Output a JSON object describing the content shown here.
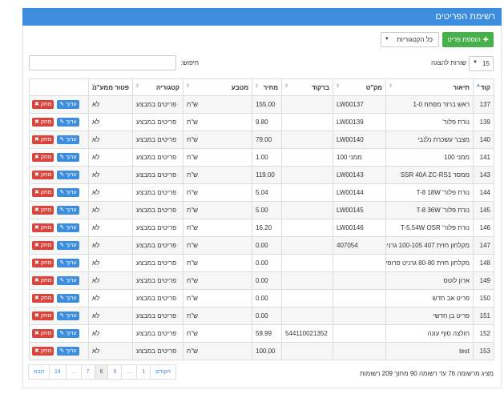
{
  "header": {
    "title": "רשימת הפריטים"
  },
  "toolbar": {
    "add_label": "הוספת פריט",
    "category_select": "כל הקטגוריות",
    "page_length": "15",
    "page_length_label": "שורות להצגה",
    "search_label": "חיפוש:",
    "search_value": ""
  },
  "table": {
    "columns": [
      "קוד",
      "תיאור",
      "מק\"ט",
      "ברקוד",
      "מחיר",
      "מטבע",
      "קטגוריה",
      "פטור ממע\"מ",
      ""
    ],
    "edit_label": "ערוך",
    "delete_label": "מחק",
    "rows": [
      {
        "code": "137",
        "desc": "ראש ברזר מפתח 1-0",
        "sku": "LW00137",
        "barcode": "",
        "price": "155.00",
        "currency": "ש\"ח",
        "category": "פריטים במבצע",
        "vat": "לא"
      },
      {
        "code": "139",
        "desc": "נורת פלור'",
        "sku": "LW00139",
        "barcode": "",
        "price": "9.80",
        "currency": "ש\"ח",
        "category": "פריטים במבצע",
        "vat": "לא"
      },
      {
        "code": "140",
        "desc": "מצבר עשכרת נלנבי",
        "sku": "LW00140",
        "barcode": "",
        "price": "79.00",
        "currency": "ש\"ח",
        "category": "פריטים במבצע",
        "vat": "לא"
      },
      {
        "code": "141",
        "desc": "ממני 100",
        "sku": "ממני 100",
        "barcode": "",
        "price": "1.00",
        "currency": "ש\"ח",
        "category": "פריטים במבצע",
        "vat": "לא"
      },
      {
        "code": "143",
        "desc": "ממסר SSR 40A ZC-RS1",
        "sku": "LW00143",
        "barcode": "",
        "price": "119.00",
        "currency": "ש\"ח",
        "category": "פריטים במבצע",
        "vat": "לא"
      },
      {
        "code": "144",
        "desc": "נורת פלור' T-8 18W",
        "sku": "LW00144",
        "barcode": "",
        "price": "5.04",
        "currency": "ש\"ח",
        "category": "פריטים במבצע",
        "vat": "לא"
      },
      {
        "code": "145",
        "desc": "נורת פלור' T-8 36W",
        "sku": "LW00145",
        "barcode": "",
        "price": "5.00",
        "currency": "ש\"ח",
        "category": "פריטים במבצע",
        "vat": "לא"
      },
      {
        "code": "146",
        "desc": "נורת פלור' T-5.54W OSR",
        "sku": "LW00146",
        "barcode": "",
        "price": "16.20",
        "currency": "ש\"ח",
        "category": "פריטים במבצע",
        "vat": "לא"
      },
      {
        "code": "147",
        "desc": "מקלחון חזית 407 100-105 גרניט",
        "sku": "407054",
        "barcode": "",
        "price": "0.00",
        "currency": "ש\"ח",
        "category": "פריטים במבצע",
        "vat": "לא"
      },
      {
        "code": "148",
        "desc": "מקלחון חזית 80-80 גרניט פרופילון",
        "sku": "",
        "barcode": "",
        "price": "0.00",
        "currency": "ש\"ח",
        "category": "פריטים במבצע",
        "vat": "לא"
      },
      {
        "code": "149",
        "desc": "ארון לוטס",
        "sku": "",
        "barcode": "",
        "price": "0.00",
        "currency": "ש\"ח",
        "category": "פריטים במבצע",
        "vat": "לא"
      },
      {
        "code": "150",
        "desc": "פריט אב חדש",
        "sku": "",
        "barcode": "",
        "price": "0.00",
        "currency": "ש\"ח",
        "category": "פריטים במבצע",
        "vat": "לא"
      },
      {
        "code": "151",
        "desc": "פריט בן חדשי",
        "sku": "",
        "barcode": "",
        "price": "0.00",
        "currency": "ש\"ח",
        "category": "פריטים במבצע",
        "vat": "לא"
      },
      {
        "code": "152",
        "desc": "חולצה סוף עונה",
        "sku": "",
        "barcode": "544110021352",
        "price": "59.99",
        "currency": "ש\"ח",
        "category": "פריטים במבצע",
        "vat": "לא"
      },
      {
        "code": "153",
        "desc": "test",
        "sku": "",
        "barcode": "",
        "price": "100.00",
        "currency": "ש\"ח",
        "category": "פריטים במבצע",
        "vat": "לא"
      }
    ]
  },
  "footer": {
    "info": "מציג מרשומה 76 עד רשומה 90 מתוך 209 רשומות",
    "pages": [
      "הקודם",
      "1",
      "...",
      "5",
      "6",
      "7",
      "...",
      "14",
      "הבא"
    ],
    "active_page": "6"
  },
  "colors": {
    "header": "#3c8dde",
    "add_button": "#47b04b",
    "edit": "#3c8dde",
    "delete": "#d9453d"
  }
}
